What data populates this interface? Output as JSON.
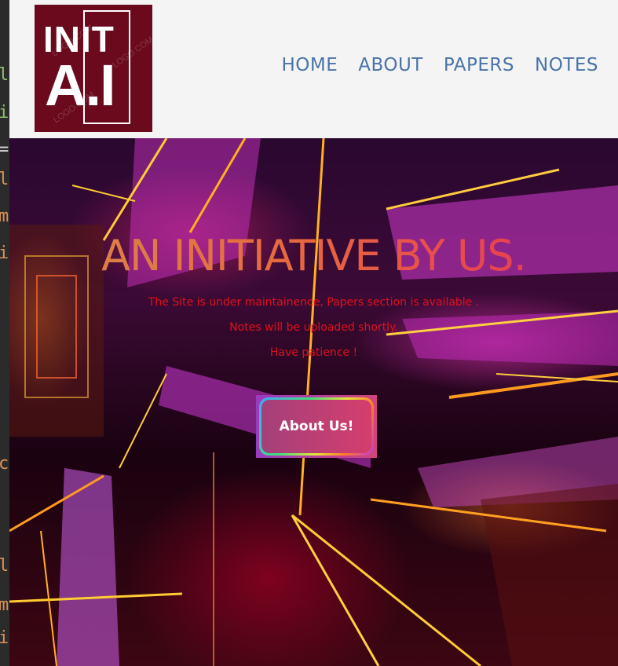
{
  "editor_glimpse": [
    "l",
    "i",
    "=",
    "l",
    "m",
    "i",
    "c",
    "l",
    "m",
    "i"
  ],
  "logo": {
    "line1": "INIT",
    "line2": "A.I",
    "watermark": "LOGO.COM",
    "bg_color": "#6a0a1c"
  },
  "nav": {
    "items": [
      {
        "label": "HOME"
      },
      {
        "label": "ABOUT"
      },
      {
        "label": "PAPERS"
      },
      {
        "label": "NOTES"
      }
    ],
    "color": "#4a74a8"
  },
  "hero": {
    "title": "AN INITIATIVE BY US.",
    "message_line1": "The Site is under maintainence, Papers section is available .",
    "message_line2": "Notes will be uploaded shortly.",
    "message_line3": "Have patience !",
    "button_label": "About Us!",
    "message_color": "#e0101a"
  }
}
